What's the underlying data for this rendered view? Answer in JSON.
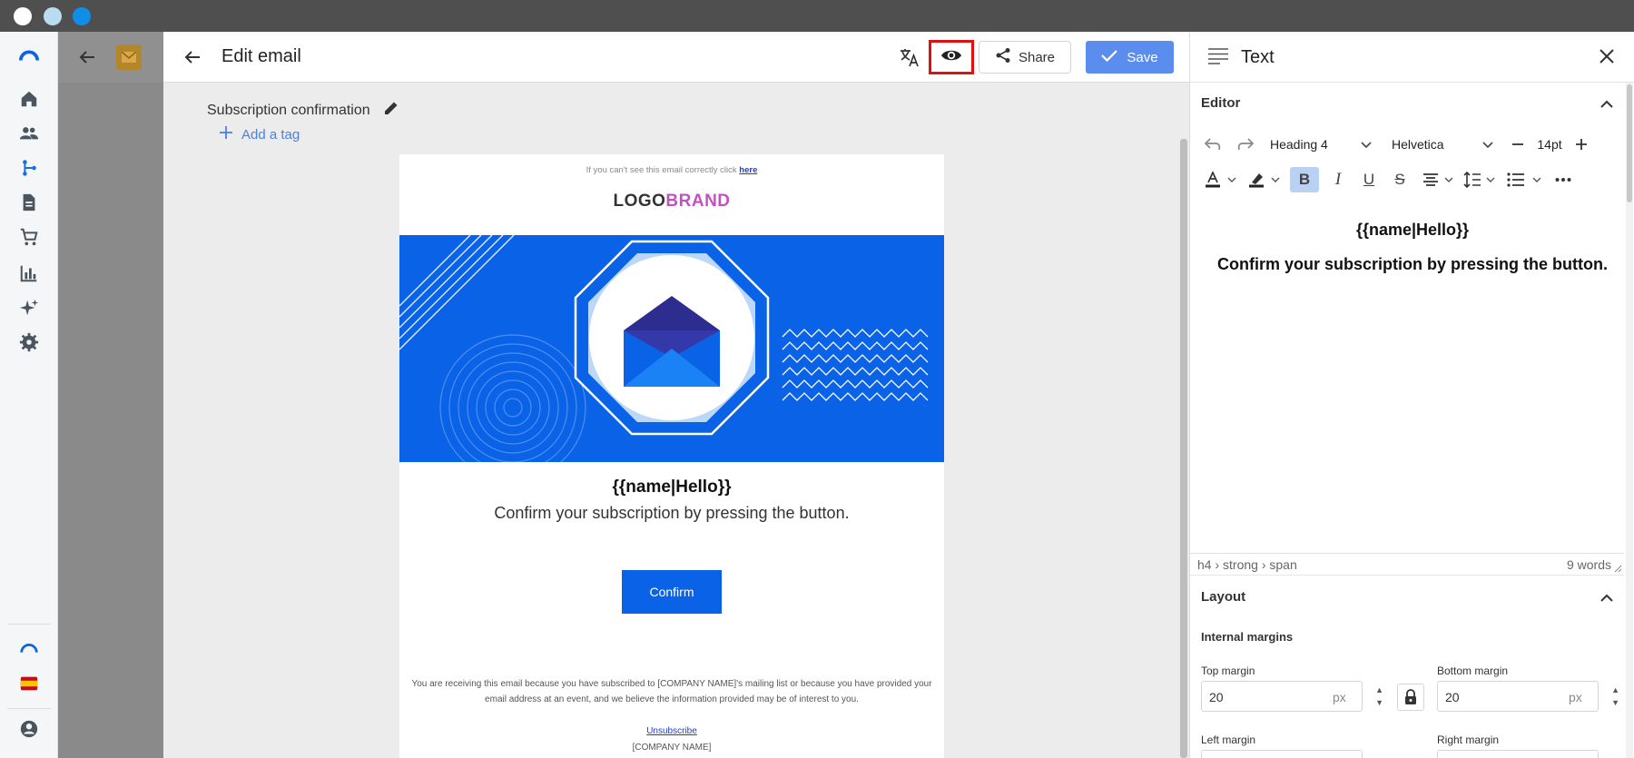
{
  "editor": {
    "title": "Edit email",
    "share_label": "Share",
    "save_label": "Save",
    "subject": "Subscription confirmation",
    "add_tag_label": "Add a tag"
  },
  "email": {
    "top_notice": "If you can't see this email correctly click",
    "top_link": "here",
    "logo_part1": "LOGO",
    "logo_part2": "BRAND",
    "heading": "{{name|Hello}}",
    "paragraph": "Confirm your subscription by pressing the button.",
    "button_label": "Confirm",
    "footer_text": "You are receiving this email because you have subscribed to [COMPANY NAME]'s mailing list or because you have provided your email address at an event, and we believe the information provided may be of interest to you.",
    "unsubscribe_label": "Unsubscribe",
    "company": "[COMPANY NAME]"
  },
  "panel": {
    "title": "Text",
    "editor_section": "Editor",
    "block_format": "Heading 4",
    "font_family": "Helvetica",
    "font_size": "14pt",
    "content_heading": "{{name|Hello}}",
    "content_paragraph": "Confirm your subscription by pressing the button.",
    "path": "h4 › strong › span",
    "word_count": "9 words",
    "layout_section": "Layout",
    "internal_margins": "Internal margins",
    "top_margin_label": "Top margin",
    "top_margin_value": "20",
    "bottom_margin_label": "Bottom margin",
    "bottom_margin_value": "20",
    "left_margin_label": "Left margin",
    "right_margin_label": "Right margin",
    "unit": "px"
  },
  "colors": {
    "accent": "#0a62e6",
    "brand_pink": "#c052c0",
    "save_button": "#5b8def",
    "highlight_outline": "#e01010"
  }
}
